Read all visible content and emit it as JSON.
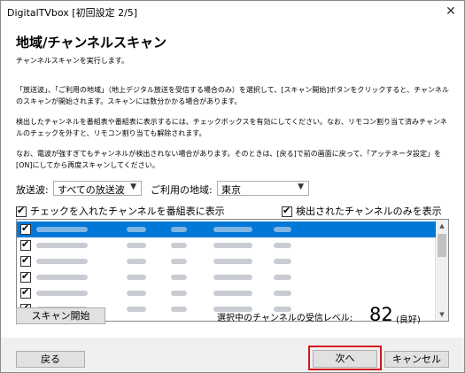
{
  "window": {
    "title": "DigitalTVbox [初回設定 2/5]"
  },
  "page": {
    "heading": "地域/チャンネルスキャン",
    "paragraphs": [
      "チャンネルスキャンを実行します。",
      "「放送波」、「ご利用の地域」（地上デジタル放送を受信する場合のみ）を選択して、[スキャン開始]ボタンをクリックすると、チャンネルのスキャンが開始されます。スキャンには数分かかる場合があります。",
      "検出したチャンネルを番組表や番組表に表示するには、チェックボックスを有効にしてください。なお、リモコン割り当て済みチャンネルのチェックを外すと、リモコン割り当ても解除されます。",
      "なお、電波が強すぎてもチャンネルが検出されない場合があります。そのときは、[戻る]で前の画面に戻って、「アッテネータ設定」を[ON]にしてから再度スキャンしてください。"
    ]
  },
  "filters": {
    "broadcast_label": "放送波:",
    "broadcast_value": "すべての放送波",
    "region_label": "ご利用の地域:",
    "region_value": "東京"
  },
  "list": {
    "header_left": "チェックを入れたチャンネルを番組表に表示",
    "header_right": "検出されたチャンネルのみを表示",
    "header_left_checked": true,
    "header_right_checked": true,
    "rows": [
      {
        "checked": true,
        "selected": true
      },
      {
        "checked": true,
        "selected": false
      },
      {
        "checked": true,
        "selected": false
      },
      {
        "checked": true,
        "selected": false
      },
      {
        "checked": true,
        "selected": false
      },
      {
        "checked": true,
        "selected": false
      }
    ]
  },
  "scan": {
    "button_label": "スキャン開始",
    "level_label": "選択中のチャンネルの受信レベル:",
    "level_value": "82",
    "level_status": "(良好)"
  },
  "footer": {
    "back_label": "戻る",
    "next_label": "次へ",
    "cancel_label": "キャンセル"
  },
  "colors": {
    "selection": "#0078d7",
    "highlight": "#d4141c"
  }
}
